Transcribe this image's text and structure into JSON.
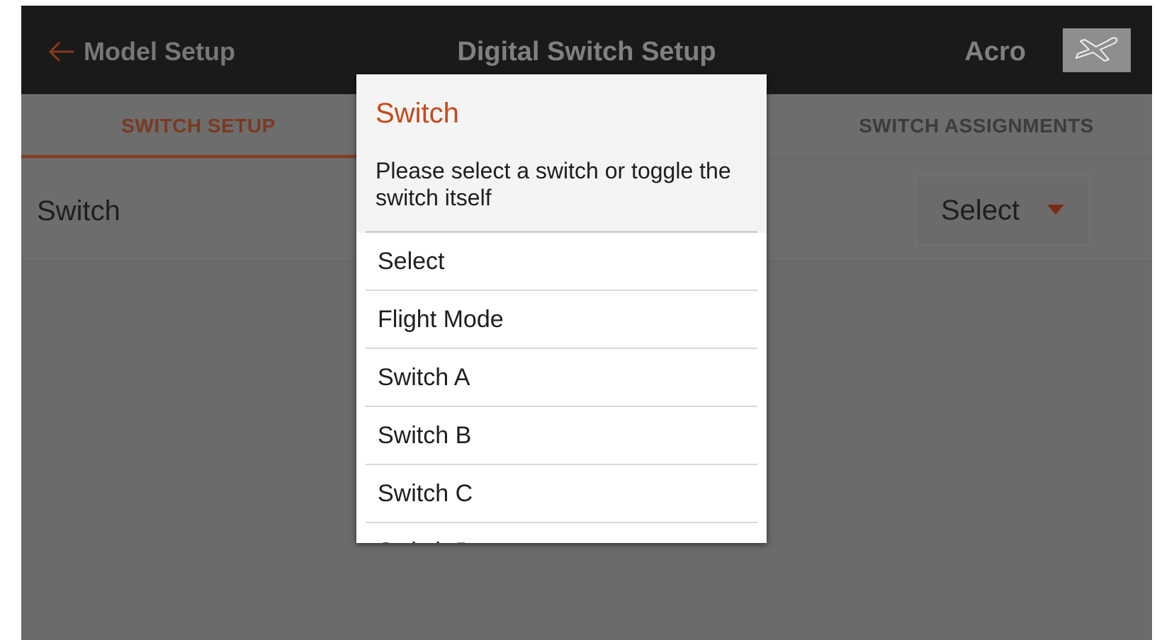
{
  "header": {
    "back_label": "Model Setup",
    "title": "Digital Switch Setup",
    "model_name": "Acro",
    "model_icon": "airplane-icon"
  },
  "tabs": [
    {
      "label": "SWITCH SETUP",
      "active": true
    },
    {
      "label": "SWITCH ASSIGNMENTS",
      "active": false
    }
  ],
  "switch_row": {
    "label": "Switch",
    "select_value": "Select"
  },
  "dialog": {
    "title": "Switch",
    "message": "Please select a switch or toggle the switch itself",
    "options": [
      "Select",
      "Flight Mode",
      "Switch A",
      "Switch B",
      "Switch C",
      "Switch D"
    ]
  },
  "colors": {
    "accent": "#c34a1a",
    "topbar": "#1a1a1a",
    "overlay_bg": "#6b6b6b"
  }
}
